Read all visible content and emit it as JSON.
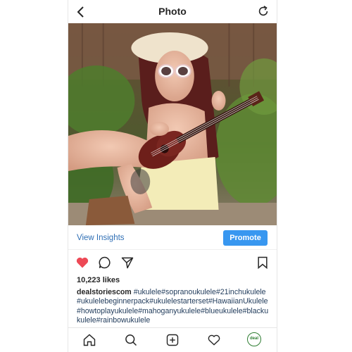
{
  "header": {
    "title": "Photo",
    "back_icon": "chevron-left-icon",
    "refresh_icon": "refresh-icon"
  },
  "post": {
    "insights_label": "View Insights",
    "promote_label": "Promote",
    "likes_text": "10,223 likes",
    "username": "dealstoriescom",
    "caption_tags": "#ukulele#sopranoukulele#21inchukulele#ukulelebeginnerpack#ukulelestarterset#HawaiianUkulele#howtoplayukulele#mahoganyukulele#blueukulele#blackukulele#rainbowukulele",
    "action_icons": [
      "heart-icon",
      "comment-icon",
      "share-icon",
      "bookmark-icon"
    ],
    "liked": true
  },
  "nav": {
    "items": [
      "home-icon",
      "search-icon",
      "add-post-icon",
      "activity-heart-icon",
      "profile-avatar"
    ],
    "avatar_text": "deal"
  },
  "colors": {
    "heart": "#ed4956",
    "link": "#2f6fb5",
    "promote": "#3897f0"
  }
}
